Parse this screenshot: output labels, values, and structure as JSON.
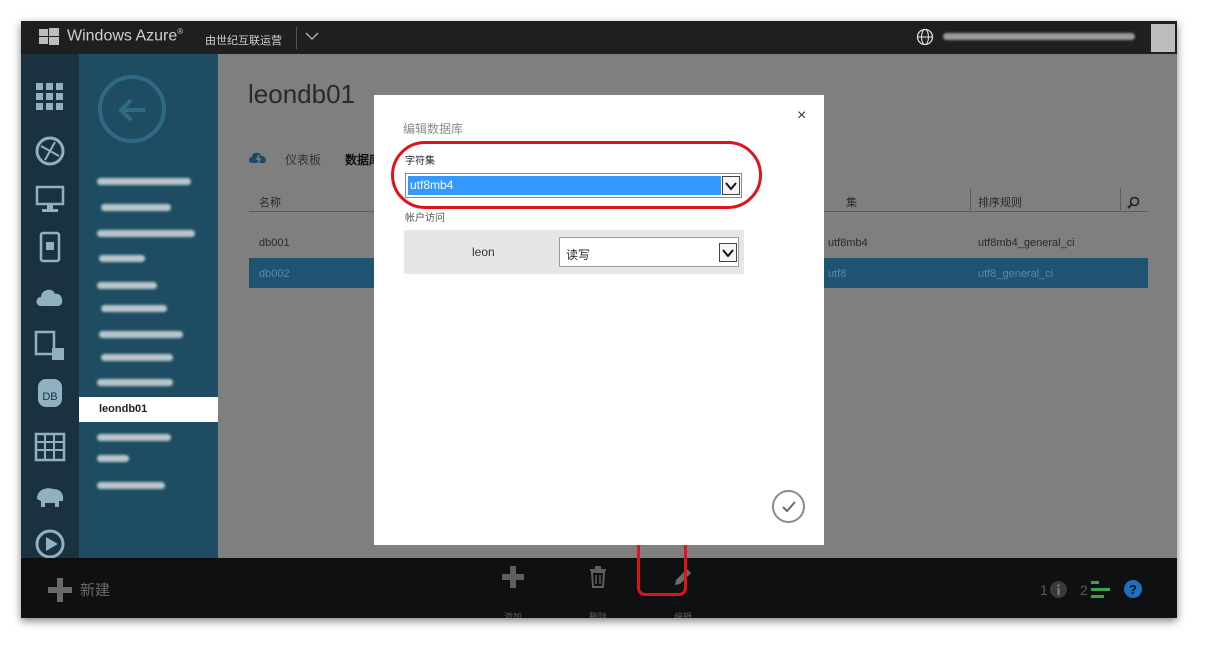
{
  "topbar": {
    "brand": "Windows Azure",
    "brand_mark": "®",
    "operator": "由世纪互联运营",
    "icons": [
      "windows-logo-icon",
      "chevron-down-icon",
      "globe-icon",
      "avatar"
    ]
  },
  "main": {
    "page_title": "leondb01",
    "tabs": [
      {
        "label": "仪表板"
      },
      {
        "label": "数据库"
      }
    ],
    "table": {
      "headers": [
        "名称",
        "集",
        "排序规则"
      ],
      "rows": [
        {
          "name": "db001",
          "charset": "utf8mb4",
          "collation": "utf8mb4_general_ci"
        },
        {
          "name": "db002",
          "charset": "utf8",
          "collation": "utf8_general_ci"
        }
      ]
    }
  },
  "nav": {
    "active_item": "leondb01"
  },
  "dialog": {
    "title": "编辑数据库",
    "close": "×",
    "charset_label": "字符集",
    "charset_value": "utf8mb4",
    "access_label": "帐户访问",
    "access_user": "leon",
    "access_permission": "读写"
  },
  "bottombar": {
    "new_label": "新建",
    "add_label": "添加",
    "delete_label": "删除",
    "edit_label": "编辑",
    "status_1": "1",
    "status_2": "2"
  },
  "colors": {
    "highlight_red": "#e0121b",
    "select_blue": "#3399ff",
    "nav_teal": "#1e4d63",
    "selected_row": "#1e5470"
  }
}
